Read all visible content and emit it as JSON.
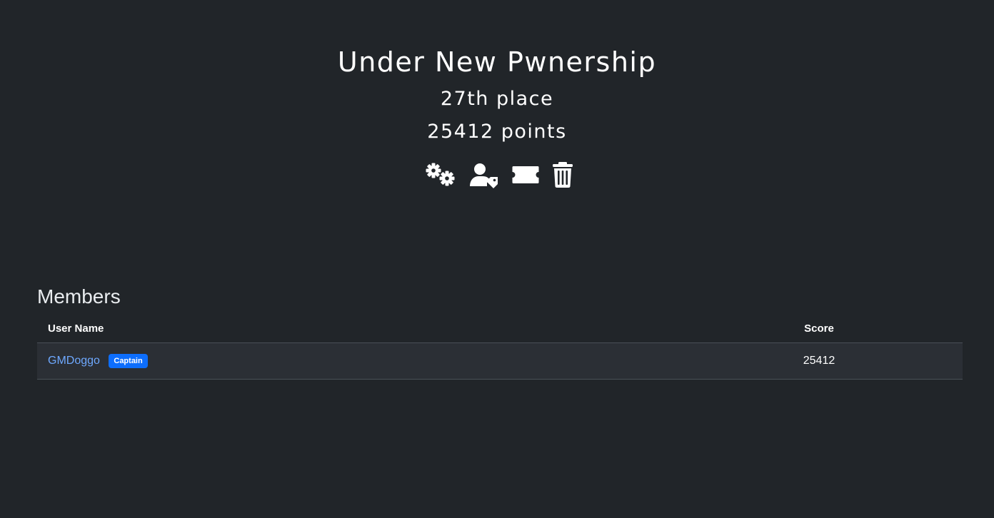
{
  "team": {
    "name": "Under New Pwnership",
    "place": "27th place",
    "points": "25412 points"
  },
  "actions": [
    {
      "icon": "gears-icon",
      "label": "Edit team settings"
    },
    {
      "icon": "user-tag-icon",
      "label": "Choose captain"
    },
    {
      "icon": "ticket-icon",
      "label": "Invite users"
    },
    {
      "icon": "trash-icon",
      "label": "Disband team"
    }
  ],
  "members": {
    "title": "Members",
    "columns": {
      "name": "User Name",
      "score": "Score"
    },
    "rows": [
      {
        "name": "GMDoggo",
        "badge": "Captain",
        "score": "25412"
      }
    ]
  },
  "colors": {
    "background": "#212529",
    "link": "#6ea8fe",
    "badge": "#0d6efd",
    "row_bg": "#2b2f35"
  }
}
